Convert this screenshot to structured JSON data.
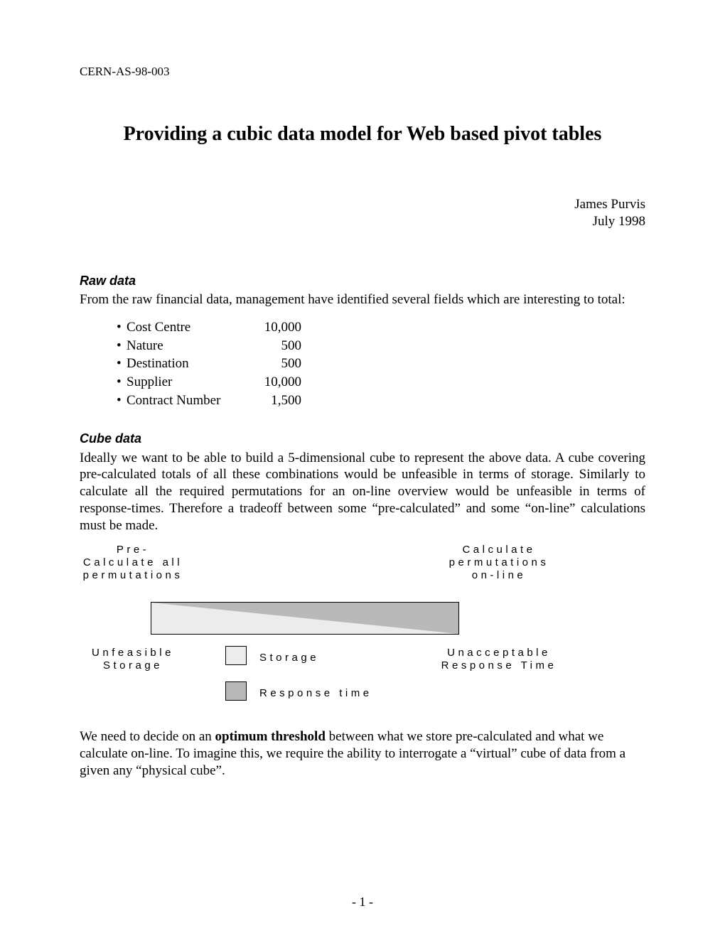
{
  "doc_id": "CERN-AS-98-003",
  "title": "Providing a cubic data model for Web based pivot tables",
  "author": "James Purvis",
  "date": "July 1998",
  "sections": {
    "raw": {
      "heading": "Raw data",
      "intro": "From the raw financial data, management have identified several fields which are interesting to total:",
      "fields": [
        {
          "name": "Cost Centre",
          "value": "10,000"
        },
        {
          "name": "Nature",
          "value": "500"
        },
        {
          "name": "Destination",
          "value": "500"
        },
        {
          "name": "Supplier",
          "value": "10,000"
        },
        {
          "name": "Contract Number",
          "value": "1,500"
        }
      ]
    },
    "cube": {
      "heading": "Cube data",
      "p1": "Ideally we want to be able to build a 5-dimensional cube to represent the above data. A cube covering pre-calculated totals of all these combinations would be unfeasible in terms of storage. Similarly to calculate all the required permutations for an on-line overview would be unfeasible in terms of response-times. Therefore a tradeoff between some “pre-calculated” and some “on-line” calculations must be made.",
      "p2a": "We need to decide on an ",
      "p2b": "optimum threshold",
      "p2c": " between what we store pre-calculated and what we calculate on-line. To imagine this, we require the ability to interrogate a “virtual” cube of data from a given any “physical cube”."
    }
  },
  "diagram": {
    "left_top1": "Pre-",
    "left_top2": "Calculate all",
    "left_top3": "permutations",
    "right_top1": "Calculate",
    "right_top2": "permutations",
    "right_top3": "on-line",
    "left_mid1": "Unfeasible",
    "left_mid2": "Storage",
    "right_mid1": "Unacceptable",
    "right_mid2": "Response Time",
    "legend_storage": "Storage",
    "legend_response": "Response time"
  },
  "page_number": "- 1 -"
}
